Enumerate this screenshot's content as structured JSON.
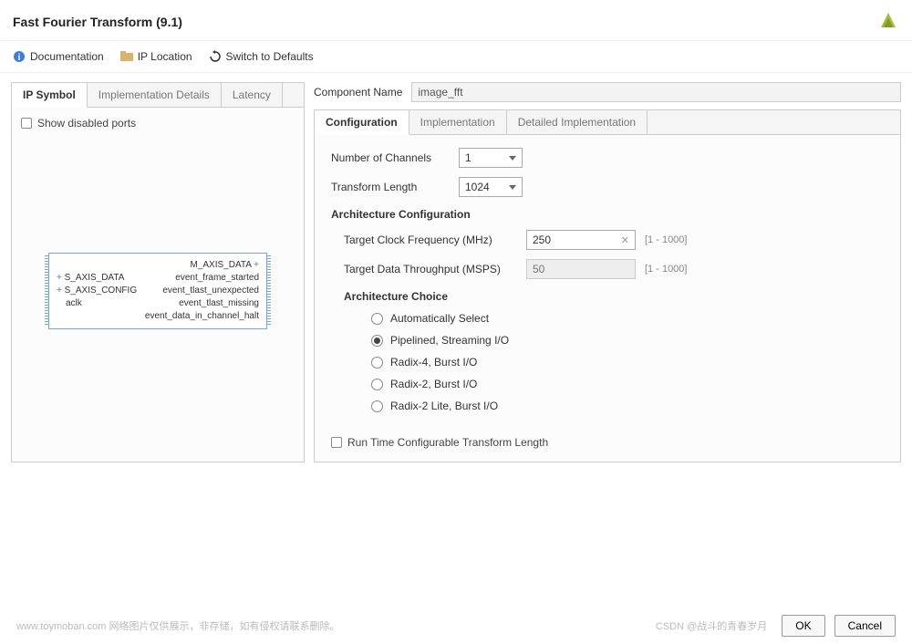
{
  "header": {
    "title": "Fast Fourier Transform (9.1)"
  },
  "toolbar": {
    "doc": "Documentation",
    "ip_location": "IP Location",
    "switch_defaults": "Switch to Defaults"
  },
  "left": {
    "tabs": [
      "IP Symbol",
      "Implementation Details",
      "Latency"
    ],
    "show_disabled": "Show disabled ports",
    "symbol": {
      "left_ports": [
        "S_AXIS_DATA",
        "S_AXIS_CONFIG",
        "aclk"
      ],
      "right_ports": [
        "M_AXIS_DATA",
        "event_frame_started",
        "event_tlast_unexpected",
        "event_tlast_missing",
        "event_data_in_channel_halt"
      ]
    }
  },
  "comp_name": {
    "label": "Component Name",
    "value": "image_fft"
  },
  "config": {
    "tabs": [
      "Configuration",
      "Implementation",
      "Detailed Implementation"
    ],
    "num_channels": {
      "label": "Number of Channels",
      "value": "1"
    },
    "transform_len": {
      "label": "Transform Length",
      "value": "1024"
    },
    "arch_config_title": "Architecture Configuration",
    "clock_freq": {
      "label": "Target Clock Frequency (MHz)",
      "value": "250",
      "range": "[1 - 1000]"
    },
    "throughput": {
      "label": "Target Data Throughput (MSPS)",
      "value": "50",
      "range": "[1 - 1000]"
    },
    "arch_choice_title": "Architecture Choice",
    "arch_choices": [
      "Automatically Select",
      "Pipelined, Streaming I/O",
      "Radix-4, Burst I/O",
      "Radix-2, Burst I/O",
      "Radix-2 Lite, Burst I/O"
    ],
    "arch_selected": 1,
    "runtime_config": "Run Time Configurable Transform Length"
  },
  "footer": {
    "left": "www.toymoban.com 网络图片仅供展示，非存储，如有侵权请联系删除。",
    "watermark": "CSDN @战斗的青春岁月",
    "ok": "OK",
    "cancel": "Cancel"
  }
}
